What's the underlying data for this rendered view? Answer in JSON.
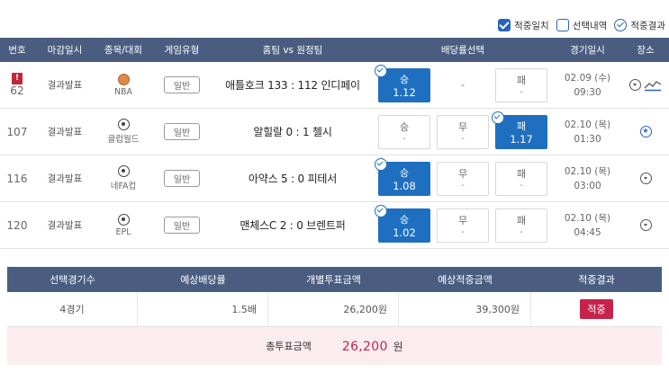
{
  "legend": {
    "match": "적중일치",
    "selection": "선택내역",
    "result": "적중결과"
  },
  "table": {
    "headers": {
      "no": "번호",
      "deadline": "마감일시",
      "sport": "종목/대회",
      "game_type": "게임유형",
      "match": "홈팀 vs 원정팀",
      "odds": "배당률선택",
      "date": "경기일시",
      "place": "장소"
    },
    "rows": [
      {
        "no": "62",
        "alert": "!",
        "deadline": "결과발표",
        "league": "NBA",
        "game_type": "일반",
        "match": "애틀호크 133 : 112 인디페이",
        "odds": [
          {
            "label": "승",
            "value": "1.12",
            "selected": true
          },
          {
            "label": "-",
            "value": "",
            "selected": false,
            "plain": true
          },
          {
            "label": "패",
            "value": "-",
            "selected": false
          }
        ],
        "date": "02.09 (수)",
        "time": "09:30"
      },
      {
        "no": "107",
        "deadline": "결과발표",
        "league": "클럽월드",
        "game_type": "일반",
        "match": "알힐랄 0 : 1 첼시",
        "odds": [
          {
            "label": "승",
            "value": "-",
            "selected": false
          },
          {
            "label": "무",
            "value": "-",
            "selected": false
          },
          {
            "label": "패",
            "value": "1.17",
            "selected": true
          }
        ],
        "date": "02.10 (목)",
        "time": "01:30"
      },
      {
        "no": "116",
        "deadline": "결과발표",
        "league": "네FA컵",
        "game_type": "일반",
        "match": "아약스 5 : 0 피테서",
        "odds": [
          {
            "label": "승",
            "value": "1.08",
            "selected": true
          },
          {
            "label": "무",
            "value": "-",
            "selected": false
          },
          {
            "label": "패",
            "value": "-",
            "selected": false
          }
        ],
        "date": "02.10 (목)",
        "time": "03:00"
      },
      {
        "no": "120",
        "deadline": "결과발표",
        "league": "EPL",
        "game_type": "일반",
        "match": "맨체스C 2 : 0 브렌트퍼",
        "odds": [
          {
            "label": "승",
            "value": "1.02",
            "selected": true
          },
          {
            "label": "무",
            "value": "-",
            "selected": false
          },
          {
            "label": "패",
            "value": "-",
            "selected": false
          }
        ],
        "date": "02.10 (목)",
        "time": "04:45"
      }
    ]
  },
  "summary": {
    "headers": {
      "games": "선택경기수",
      "odds": "예상배당률",
      "bet": "개별투표금액",
      "expected": "예상적중금액",
      "result": "적중결과"
    },
    "values": {
      "games": "4경기",
      "odds": "1.5배",
      "bet": "26,200원",
      "expected": "39,300원",
      "result": "적중"
    },
    "total_label": "총투표금액",
    "total_amount": "26,200",
    "total_unit": "원"
  },
  "colors": {
    "header_bg": "#4a5d80",
    "accent_blue": "#1f6fc1",
    "win_badge": "#c6234c",
    "total_bg": "#fbecef"
  }
}
